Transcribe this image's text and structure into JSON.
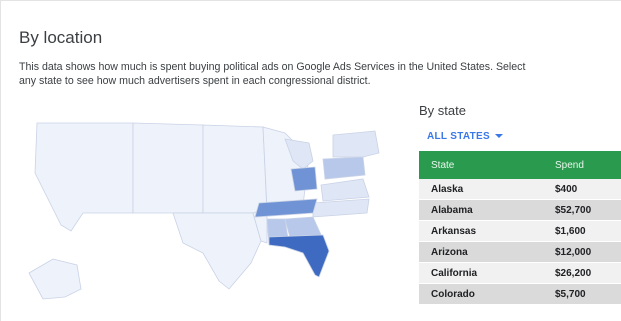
{
  "section": {
    "title": "By location",
    "description": "This data shows how much is spent buying political ads on Google Ads Services in the United States. Select any state to see how much advertisers spent in each congressional district."
  },
  "by_state": {
    "title": "By state",
    "filter_label": "ALL STATES",
    "columns": [
      "State",
      "Spend"
    ],
    "rows": [
      {
        "state": "Alaska",
        "spend": "$400"
      },
      {
        "state": "Alabama",
        "spend": "$52,700"
      },
      {
        "state": "Arkansas",
        "spend": "$1,600"
      },
      {
        "state": "Arizona",
        "spend": "$12,000"
      },
      {
        "state": "California",
        "spend": "$26,200"
      },
      {
        "state": "Colorado",
        "spend": "$5,700"
      }
    ]
  },
  "colors": {
    "header_green": "#2a9b4e",
    "accent_blue": "#3b78e7",
    "map_highest": "#3e6bc1",
    "map_high": "#6f93d4",
    "map_mid": "#b7c8ea",
    "map_low": "#dfe6f5",
    "map_base": "#eef2fa"
  }
}
